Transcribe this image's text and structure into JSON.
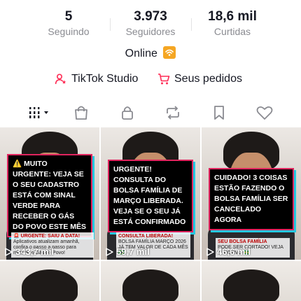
{
  "stats": [
    {
      "value": "5",
      "label": "Seguindo"
    },
    {
      "value": "3.973",
      "label": "Seguidores"
    },
    {
      "value": "18,6 mil",
      "label": "Curtidas"
    }
  ],
  "status": {
    "text": "Online"
  },
  "links": {
    "studio": "TikTok Studio",
    "orders": "Seus pedidos"
  },
  "colors": {
    "studio_icon": "#fe2c55",
    "orders_icon": "#fe2c55",
    "status_icon": "#f5a623"
  },
  "videos": [
    {
      "caption": "⚠️ MUITO URGENTE: VEJA SE O SEU CADASTRO ESTÁ COM SINAL VERDE PARA RECEBER O GÁS DO POVO ESTE MÊS",
      "sub_title": "🚨 URGENTE: SAIU A DATA!",
      "sub_text": "Aplicativos atualizam amanhã, confira o passo a passo para mostrar o Gás do Povo!",
      "views": "343,7 mil"
    },
    {
      "caption": "URGENTE! CONSULTA DO BOLSA FAMÍLIA DE MARÇO LIBERADA. VEJA SE O SEU JÁ ESTÁ CONFIRMADO",
      "sub_title": "CONSULTA LIBERADA!",
      "sub_text": "BOLSA FAMÍLIA MARÇO 2026 JÁ TEM VALOR DE CADA MÊS 🇧🇷",
      "views": "59,7 mil"
    },
    {
      "caption": "CUIDADO! 3 COISAS ESTÃO FAZENDO O BOLSA FAMÍLIA SER CANCELADO AGORA",
      "sub_title": "SEU BOLSA FAMÍLIA",
      "sub_text": "PODE SER CORTADO! VEJA O MOTIVO 🇧🇷",
      "views": "46,6 mil"
    }
  ]
}
